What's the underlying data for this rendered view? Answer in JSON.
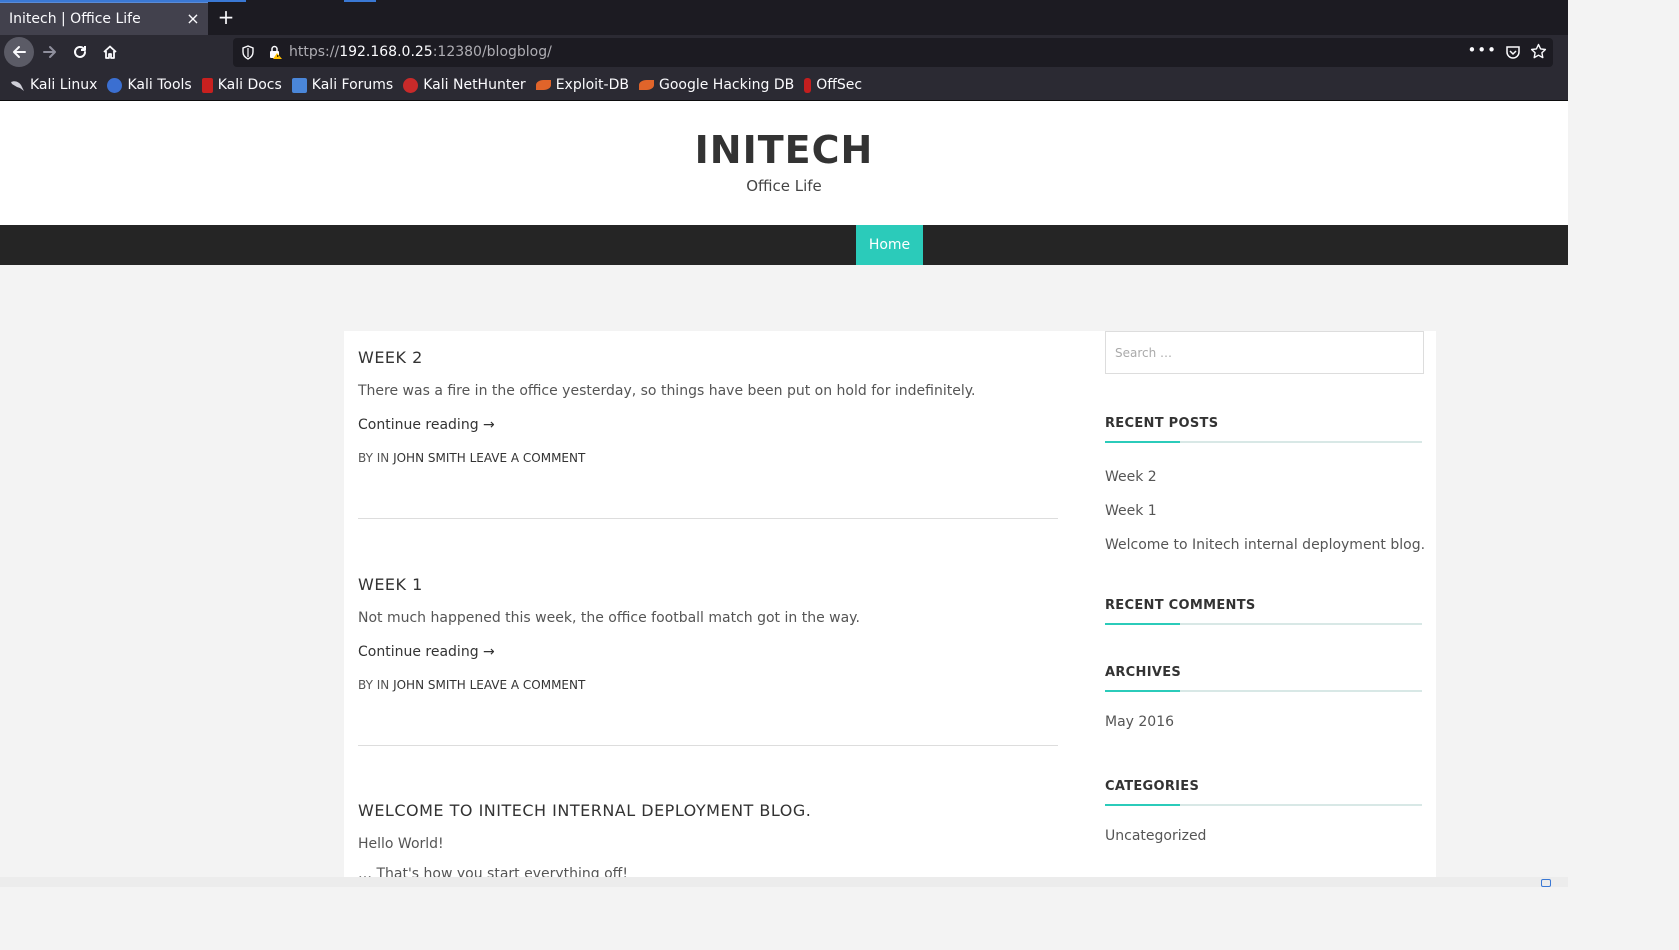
{
  "browser": {
    "tab_title": "Initech | Office Life",
    "tab_close": "×",
    "new_tab": "+",
    "url_prefix": "https://",
    "url_host": "192.168.0.25",
    "url_rest": ":12380/blogblog/",
    "url_more": "•••",
    "bookmarks": [
      {
        "label": "Kali Linux",
        "icon": "kali-dragon-icon",
        "color": "#222222"
      },
      {
        "label": "Kali Tools",
        "icon": "kali-tools-icon",
        "color": "#3b6fd1"
      },
      {
        "label": "Kali Docs",
        "icon": "kali-docs-icon",
        "color": "#c8201f"
      },
      {
        "label": "Kali Forums",
        "icon": "kali-forums-icon",
        "color": "#4a86d9"
      },
      {
        "label": "Kali NetHunter",
        "icon": "kali-nethunter-icon",
        "color": "#c82a2a"
      },
      {
        "label": "Exploit-DB",
        "icon": "exploit-db-icon",
        "color": "#e0642a"
      },
      {
        "label": "Google Hacking DB",
        "icon": "ghdb-icon",
        "color": "#e0642a"
      },
      {
        "label": "OffSec",
        "icon": "offsec-icon",
        "color": "#c41e1e"
      }
    ]
  },
  "site": {
    "title": "INITECH",
    "description": "Office Life",
    "nav": {
      "home": "Home"
    },
    "accent_color": "#2bcbba"
  },
  "posts": [
    {
      "title": "WEEK 2",
      "excerpt": "There was a fire in the office yesterday, so things have been put on hold for indefinitely.",
      "more": "Continue reading →",
      "meta_prefix": "BY IN ",
      "author": "JOHN SMITH",
      "comment_link": "LEAVE A COMMENT"
    },
    {
      "title": "WEEK 1",
      "excerpt": "Not much happened this week, the office football match got in the way.",
      "more": "Continue reading →",
      "meta_prefix": "BY IN ",
      "author": "JOHN SMITH",
      "comment_link": "LEAVE A COMMENT"
    },
    {
      "title": "WELCOME TO INITECH INTERNAL DEPLOYMENT BLOG.",
      "excerpt": "Hello World!",
      "partial": "… That's how you start everything off!"
    }
  ],
  "sidebar": {
    "search_placeholder": "Search …",
    "recent_posts": {
      "title": "RECENT POSTS",
      "items": [
        "Week 2",
        "Week 1",
        "Welcome to Initech internal deployment blog."
      ]
    },
    "recent_comments": {
      "title": "RECENT COMMENTS"
    },
    "archives": {
      "title": "ARCHIVES",
      "items": [
        "May 2016"
      ]
    },
    "categories": {
      "title": "CATEGORIES",
      "items": [
        "Uncategorized"
      ]
    }
  }
}
